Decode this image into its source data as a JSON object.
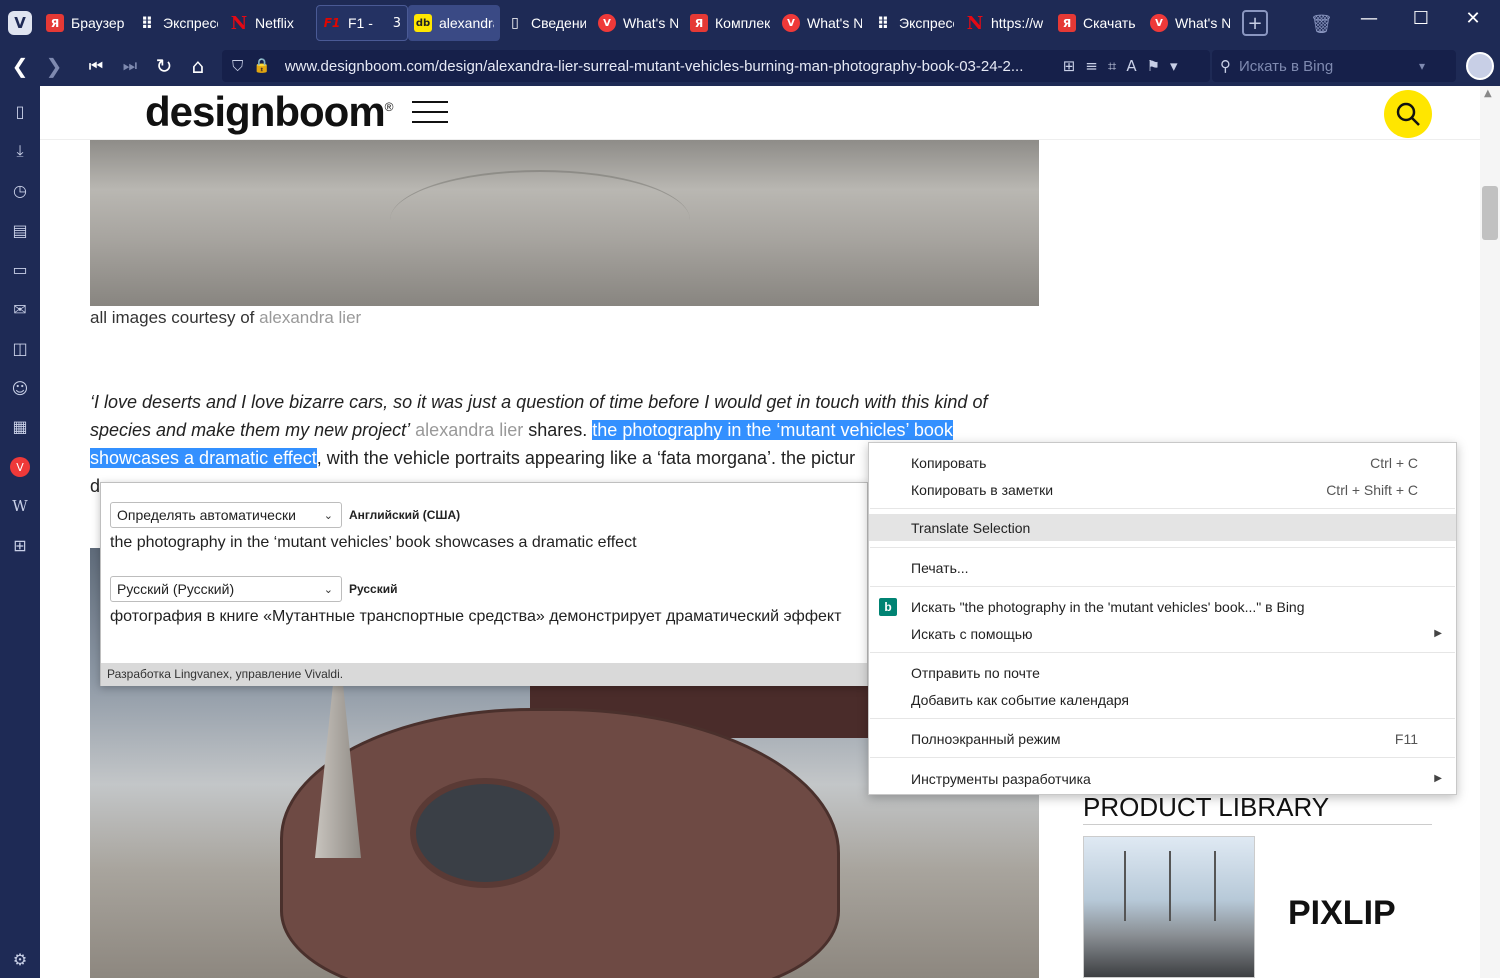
{
  "browser": {
    "tabs": [
      {
        "label": "Браузер",
        "icon": "yandex-icon"
      },
      {
        "label": "Экспресс",
        "icon": "grid-icon"
      },
      {
        "label": "Netflix",
        "icon": "netflix-icon"
      },
      {
        "label": "F1 -",
        "icon": "f1-icon",
        "count": "3"
      },
      {
        "label": "alexandra",
        "icon": "designboom-icon"
      },
      {
        "label": "Сведения",
        "icon": "document-icon"
      },
      {
        "label": "What's New",
        "icon": "vivaldi-icon"
      },
      {
        "label": "Комплект",
        "icon": "yandex-icon"
      },
      {
        "label": "What's New",
        "icon": "vivaldi-icon"
      },
      {
        "label": "Экспресс",
        "icon": "grid-icon"
      },
      {
        "label": "https://w",
        "icon": "netflix-icon"
      },
      {
        "label": "Скачать",
        "icon": "yandex-icon"
      },
      {
        "label": "What's New",
        "icon": "vivaldi-icon"
      }
    ],
    "url": "www.designboom.com/design/alexandra-lier-surreal-mutant-vehicles-burning-man-photography-book-03-24-2...",
    "search_placeholder": "Искать в Bing"
  },
  "page": {
    "logo": "designboom",
    "caption_prefix": "all images courtesy of",
    "caption_credit": "alexandra lier",
    "para": {
      "quote": "‘I love deserts and I love bizarre cars, so it was just a question of time before I would get in touch with this kind of species and make them my new project’",
      "author": "alexandra lier",
      "shares": "shares.",
      "selected_1": "the photography in the ‘mutant vehicles’ book",
      "selected_2": "showcases a dramatic effect",
      "tail": ", with the vehicle portraits appearing like a ‘fata morgana’. the pictur",
      "line3_start": "d"
    },
    "sidebar": {
      "heading": "PRODUCT LIBRARY",
      "brand": "PIXLIP"
    }
  },
  "translate_popup": {
    "source_select": "Определять автоматически",
    "source_detected": "Английский (США)",
    "source_text": "the photography in the ‘mutant vehicles’ book showcases a dramatic effect",
    "target_select": "Русский (Русский)",
    "target_lang": "Русский",
    "target_text": "фотография в книге «Мутантные транспортные средства» демонстрирует драматический эффект",
    "footer": "Разработка Lingvanex, управление Vivaldi."
  },
  "context_menu": {
    "copy": "Копировать",
    "copy_shortcut": "Ctrl + C",
    "copy_notes": "Копировать в заметки",
    "copy_notes_shortcut": "Ctrl + Shift + C",
    "translate": "Translate Selection",
    "print": "Печать...",
    "search_bing": "Искать \"the photography in the 'mutant vehicles' book...\" в Bing",
    "search_with": "Искать с помощью",
    "send_mail": "Отправить по почте",
    "add_calendar": "Добавить как событие календаря",
    "fullscreen": "Полноэкранный режим",
    "fullscreen_shortcut": "F11",
    "devtools": "Инструменты разработчика"
  }
}
